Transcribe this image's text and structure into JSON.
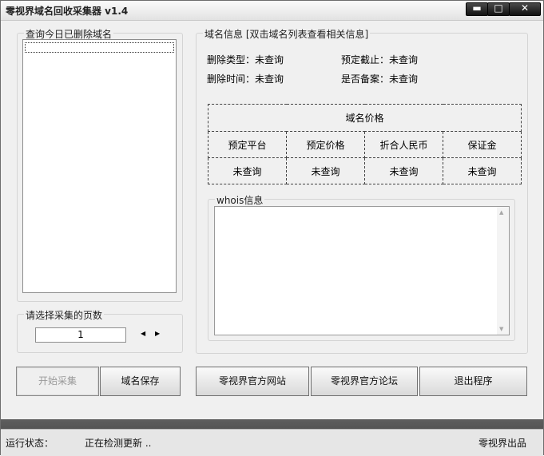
{
  "window": {
    "title": "零视界域名回收采集器 v1.4",
    "min_glyph": "▬",
    "max_glyph": "□",
    "close_glyph": "✕"
  },
  "deleted_list": {
    "legend": "查询今日已删除域名"
  },
  "domain_info": {
    "legend": "域名信息 [双击域名列表查看相关信息]",
    "delete_type_label": "删除类型：",
    "delete_type_value": "未查询",
    "delete_time_label": "删除时间：",
    "delete_time_value": "未查询",
    "reserve_deadline_label": "预定截止：",
    "reserve_deadline_value": "未查询",
    "icp_label": "是否备案：",
    "icp_value": "未查询"
  },
  "price_table": {
    "title": "域名价格",
    "headers": [
      "预定平台",
      "预定价格",
      "折合人民币",
      "保证金"
    ],
    "values": [
      "未查询",
      "未查询",
      "未查询",
      "未查询"
    ]
  },
  "whois": {
    "legend": "whois信息"
  },
  "pages": {
    "legend": "请选择采集的页数",
    "value": "1",
    "left_arrow": "◀",
    "right_arrow": "▶"
  },
  "buttons": {
    "start": "开始采集",
    "save": "域名保存",
    "site": "零视界官方网站",
    "forum": "零视界官方论坛",
    "exit": "退出程序"
  },
  "status": {
    "label": "运行状态：",
    "text": "正在检测更新 ..",
    "brand": "零视界出品"
  }
}
